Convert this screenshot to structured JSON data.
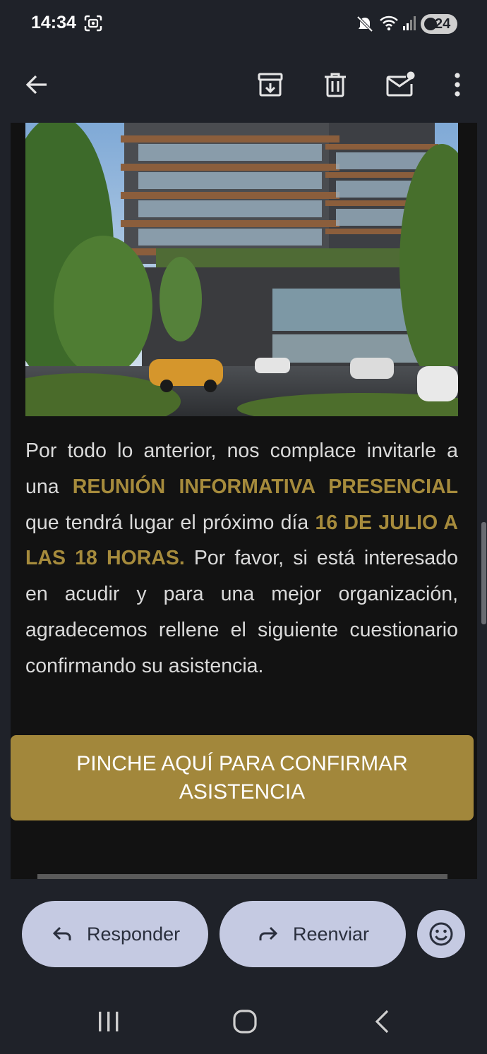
{
  "status_bar": {
    "time": "14:34",
    "battery": "24",
    "icons": [
      "screenshot-icon",
      "mute-icon",
      "wifi-icon",
      "signal-icon",
      "battery-icon"
    ]
  },
  "app_bar": {
    "icons": [
      "back-arrow-icon",
      "archive-icon",
      "trash-icon",
      "mark-unread-icon",
      "more-vert-icon"
    ]
  },
  "email": {
    "paragraph": {
      "p1": "Por todo lo anterior, nos complace invitarle a una ",
      "highlight1": "REUNIÓN INFORMATIVA PRESENCIAL",
      "p2": " que tendrá lugar el próximo día ",
      "highlight2": "16 DE JULIO A LAS 18 HORAS.",
      "p3": " Por favor, si está interesado en acudir y para una mejor organización, agradecemos rellene el siguiente cuestionario confirmando su asistencia."
    },
    "cta_label": "PINCHE AQUÍ PARA CONFIRMAR ASISTENCIA"
  },
  "actions": {
    "reply_label": "Responder",
    "forward_label": "Reenviar"
  },
  "colors": {
    "accent_gold": "#a2873b",
    "pill_bg": "#c5cae2",
    "surface": "#1f2229",
    "email_bg": "#121212"
  }
}
